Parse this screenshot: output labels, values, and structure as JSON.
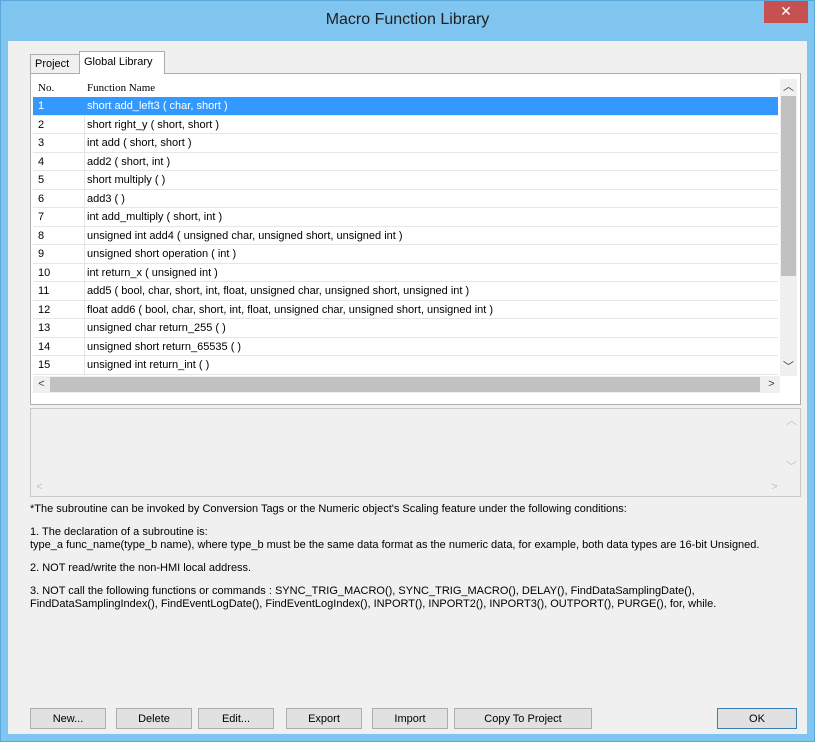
{
  "window": {
    "title": "Macro Function Library",
    "close_label": "✕"
  },
  "tabs": [
    {
      "label": "Project",
      "active": false
    },
    {
      "label": "Global Library",
      "active": true
    }
  ],
  "list": {
    "columns": {
      "no": "No.",
      "name": "Function Name"
    },
    "rows": [
      {
        "no": "1",
        "name": "short add_left3 ( char, short )",
        "selected": true
      },
      {
        "no": "2",
        "name": "short right_y ( short, short )"
      },
      {
        "no": "3",
        "name": "int add ( short, short )"
      },
      {
        "no": "4",
        "name": "add2 ( short, int )"
      },
      {
        "no": "5",
        "name": "short multiply ( )"
      },
      {
        "no": "6",
        "name": "add3 ( )"
      },
      {
        "no": "7",
        "name": "int add_multiply ( short, int )"
      },
      {
        "no": "8",
        "name": "unsigned int add4 ( unsigned char, unsigned short, unsigned int )"
      },
      {
        "no": "9",
        "name": "unsigned short operation ( int )"
      },
      {
        "no": "10",
        "name": "int return_x ( unsigned int )"
      },
      {
        "no": "11",
        "name": "add5 ( bool, char, short, int, float, unsigned char, unsigned short, unsigned int )"
      },
      {
        "no": "12",
        "name": "float add6 ( bool, char, short, int, float, unsigned char, unsigned short, unsigned int )"
      },
      {
        "no": "13",
        "name": "unsigned char return_255 ( )"
      },
      {
        "no": "14",
        "name": "unsigned short return_65535 ( )"
      },
      {
        "no": "15",
        "name": "unsigned int return_int ( )"
      }
    ]
  },
  "icons": {
    "up": "chevron-up-icon",
    "down": "chevron-down-icon",
    "left": "chevron-left-icon",
    "right": "chevron-right-icon"
  },
  "notes": {
    "intro": "*The subroutine can be invoked by Conversion Tags or the Numeric object's Scaling feature under the following conditions:",
    "item1_title": "1. The declaration of a subroutine is:",
    "item1_body": "type_a func_name(type_b name), where type_b must be the same data format as the numeric data, for example, both data types are 16-bit Unsigned.",
    "item2": "2. NOT read/write the non-HMI local address.",
    "item3": "3. NOT call the following functions or commands : SYNC_TRIG_MACRO(), SYNC_TRIG_MACRO(), DELAY(), FindDataSamplingDate(), FindDataSamplingIndex(), FindEventLogDate(), FindEventLogIndex(), INPORT(), INPORT2(), INPORT3(), OUTPORT(), PURGE(), for, while."
  },
  "buttons": {
    "new": "New...",
    "delete": "Delete",
    "edit": "Edit...",
    "export": "Export",
    "import": "Import",
    "copy_to_project": "Copy To Project",
    "ok": "OK"
  },
  "colors": {
    "title_bar": "#80c4f0",
    "close_button": "#c75050",
    "selection": "#3399ff"
  }
}
